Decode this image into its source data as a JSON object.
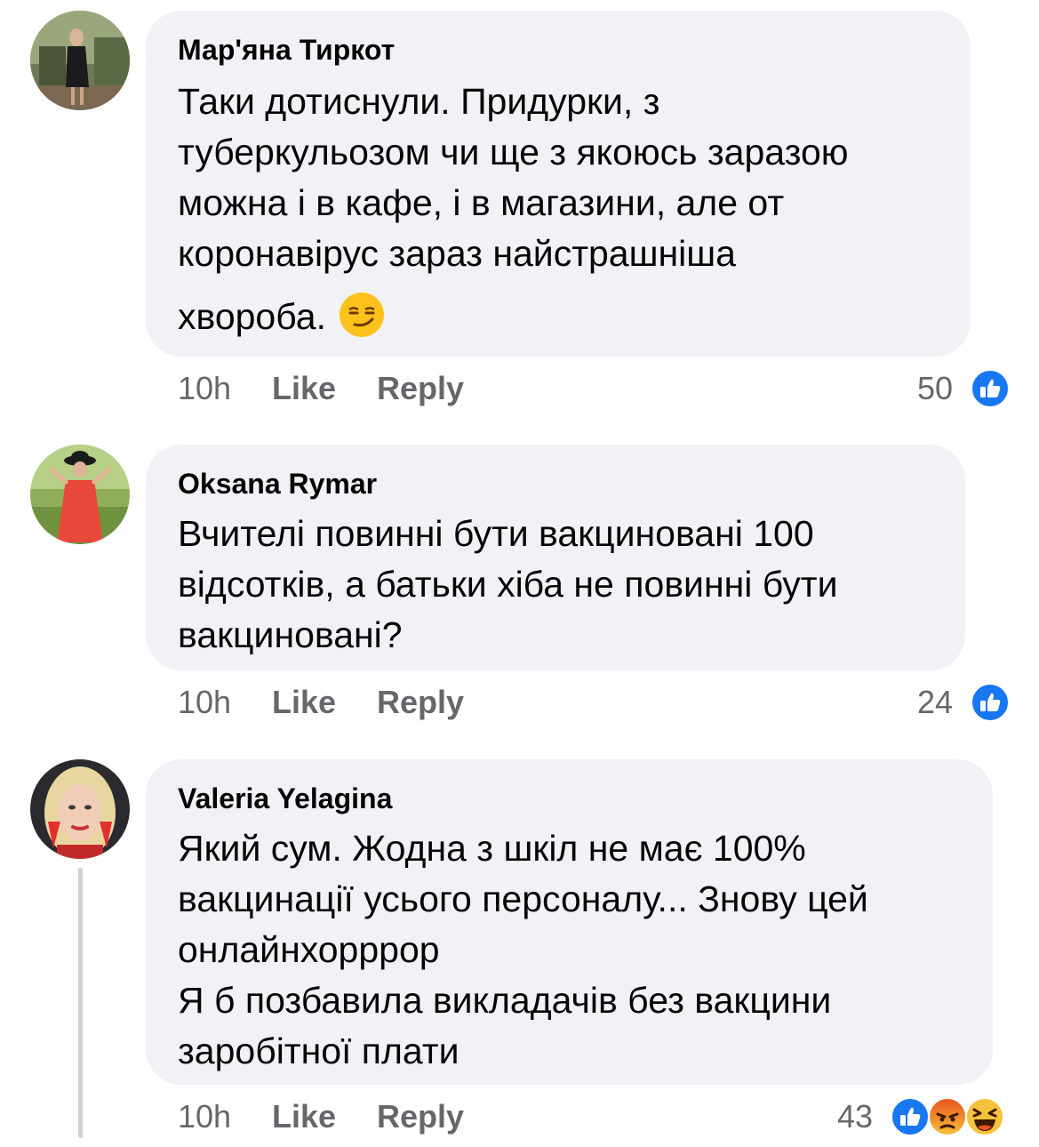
{
  "comments": [
    {
      "author": "Мар'яна Тиркот",
      "lines": [
        "Таки дотиснули. Придурки, з",
        "туберкульозом чи ще з якоюсь заразою",
        "можна і в кафе, і в магазини, але от",
        "коронавірус зараз найстрашніша",
        "хвороба."
      ],
      "trailing_emoji": "smirking-face",
      "time": "10h",
      "like_label": "Like",
      "reply_label": "Reply",
      "reaction_count": "50",
      "reactions": [
        "like"
      ]
    },
    {
      "author": "Oksana Rymar",
      "lines": [
        "Вчителі повинні бути вакциновані 100",
        "відсотків, а батьки  хіба не повинні бути",
        "вакциновані?"
      ],
      "time": "10h",
      "like_label": "Like",
      "reply_label": "Reply",
      "reaction_count": "24",
      "reactions": [
        "like"
      ]
    },
    {
      "author": "Valeria Yelagina",
      "lines": [
        "Який сум. Жодна з шкіл не має 100%",
        "вакцинації усього персоналу... Знову цей",
        "онлайнхорррор",
        "Я б позбавила викладачів без вакцини",
        "заробітної плати"
      ],
      "time": "10h",
      "like_label": "Like",
      "reply_label": "Reply",
      "reaction_count": "43",
      "reactions": [
        "like",
        "angry",
        "haha"
      ]
    }
  ],
  "colors": {
    "bubble": "#f0f2f5",
    "meta_text": "#65676b",
    "like_blue": "#1877f2",
    "thread_line": "#ced0d4"
  }
}
